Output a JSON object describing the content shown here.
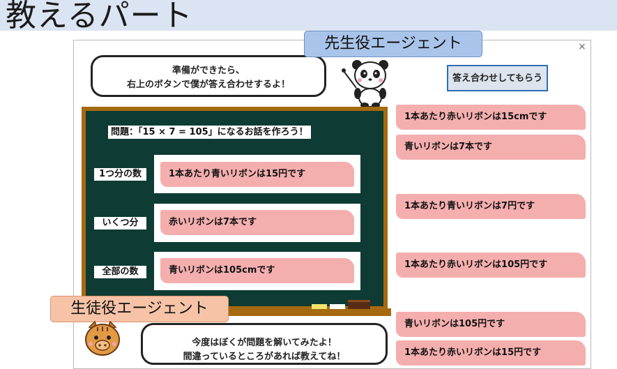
{
  "page_title": "教えるパート",
  "teacher_agent_label": "先生役エージェント",
  "student_agent_label": "生徒役エージェント",
  "teacher_bubble": {
    "line1": "準備ができたら、",
    "line2": "右上のボタンで僕が答え合わせするよ！"
  },
  "student_bubble": {
    "line1": "今度はぼくが問題を解いてみたよ！",
    "line2": "間違っているところがあれば教えてね！"
  },
  "check_button_label": "答え合わせしてもらう",
  "close_icon": "×",
  "question": "問題：「15 × 7 = 105」になるお話を作ろう！",
  "rows": [
    {
      "label": "1つ分の数",
      "answer": "1本あたり青いリボンは15円です"
    },
    {
      "label": "いくつ分",
      "answer": "赤いリボンは7本です"
    },
    {
      "label": "全部の数",
      "answer": "青いリボンは105cmです"
    }
  ],
  "option_cards": [
    "1本あたり赤いリボンは15cmです",
    "青いリボンは7本です",
    "1本あたり青いリボンは7円です",
    "1本あたり赤いリボンは105円です",
    "青いリボンは105円です",
    "1本あたり赤いリボンは15円です"
  ],
  "colors": {
    "board": "#0e3b34",
    "board_frame": "#a56a10",
    "card": "#f5aeae",
    "teacher_label": "#a9c4ea",
    "student_label": "#f7c3a7",
    "button_border": "#2e6db5"
  }
}
